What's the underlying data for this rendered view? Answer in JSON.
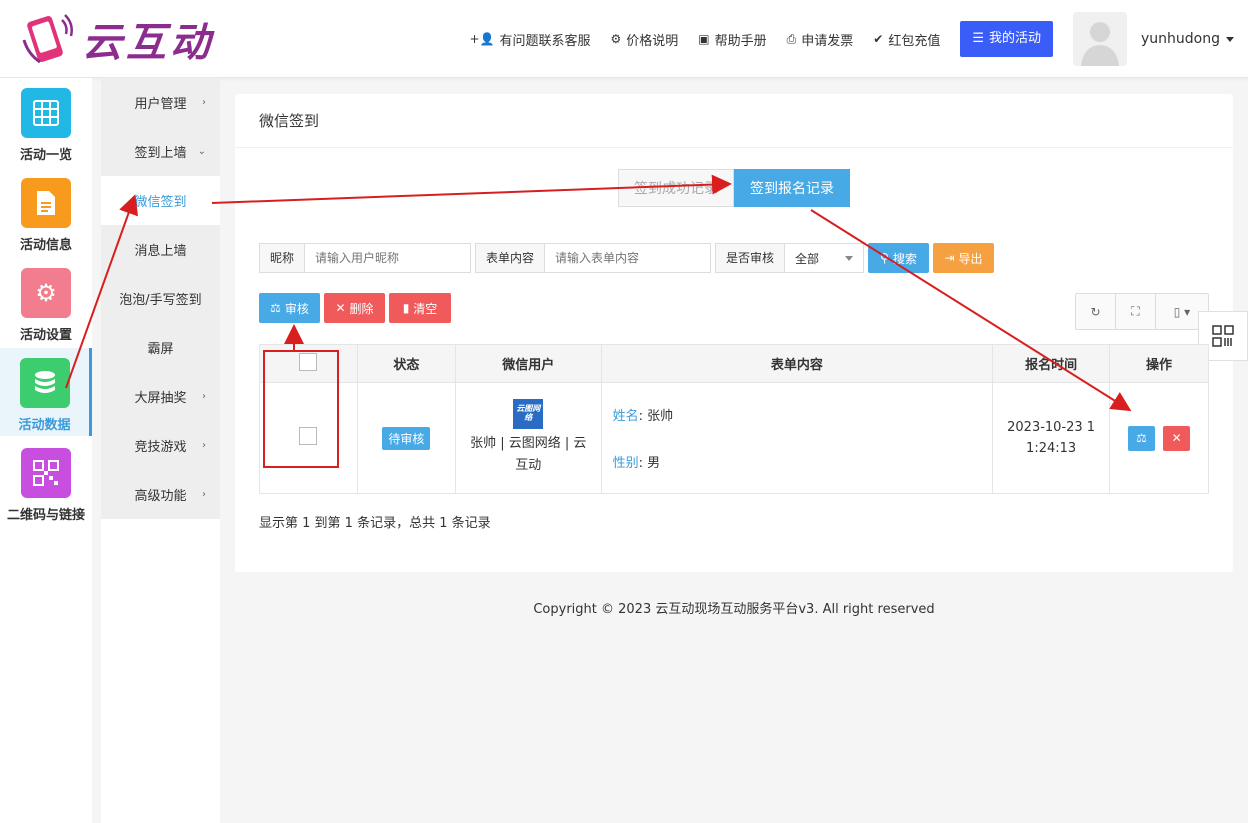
{
  "header": {
    "logo_text": "云互动",
    "nav": [
      {
        "icon": "user-plus-icon",
        "glyph": "+👤",
        "label": "有问题联系客服"
      },
      {
        "icon": "gear-icon",
        "glyph": "⚙",
        "label": "价格说明"
      },
      {
        "icon": "book-icon",
        "glyph": "▣",
        "label": "帮助手册"
      },
      {
        "icon": "printer-icon",
        "glyph": "⎙",
        "label": "申请发票"
      },
      {
        "icon": "shield-check-icon",
        "glyph": "✔",
        "label": "红包充值"
      }
    ],
    "my_activity_label": "我的活动",
    "username": "yunhudong"
  },
  "sidebar": {
    "items": [
      {
        "label": "活动一览",
        "icon": "grid-icon",
        "color": "#22b8e6"
      },
      {
        "label": "活动信息",
        "icon": "document-icon",
        "color": "#f79a1e"
      },
      {
        "label": "活动设置",
        "icon": "gear-icon",
        "color": "#f27d8e"
      },
      {
        "label": "活动数据",
        "icon": "database-icon",
        "color": "#3dcc6e"
      },
      {
        "label": "二维码与链接",
        "icon": "qrcode-icon",
        "color": "#c84ee0"
      }
    ]
  },
  "subnav": {
    "items": [
      {
        "label": "用户管理",
        "arrow": "›"
      },
      {
        "label": "签到上墙",
        "arrow": "⌄"
      },
      {
        "label": "微信签到",
        "arrow": ""
      },
      {
        "label": "消息上墙",
        "arrow": ""
      },
      {
        "label": "泡泡/手写签到",
        "arrow": ""
      },
      {
        "label": "霸屏",
        "arrow": ""
      },
      {
        "label": "大屏抽奖",
        "arrow": "›"
      },
      {
        "label": "竞技游戏",
        "arrow": "›"
      },
      {
        "label": "高级功能",
        "arrow": "›"
      }
    ]
  },
  "panel": {
    "title": "微信签到",
    "tabs": [
      "签到成功记录",
      "签到报名记录"
    ],
    "filters": {
      "nickname_label": "昵称",
      "nickname_placeholder": "请输入用户昵称",
      "form_label": "表单内容",
      "form_placeholder": "请输入表单内容",
      "review_label": "是否审核",
      "review_value": "全部",
      "search_label": "搜索",
      "export_label": "导出"
    },
    "actions": {
      "review_label": "审核",
      "delete_label": "删除",
      "clear_label": "清空"
    },
    "table": {
      "headers": [
        "",
        "状态",
        "微信用户",
        "表单内容",
        "报名时间",
        "操作"
      ],
      "rows": [
        {
          "status": "待审核",
          "avatar_text": "云图网络",
          "user": "张帅 | 云图网络 | 云互动",
          "form_name_key": "姓名",
          "form_name_val": "张帅",
          "form_gender_key": "性别",
          "form_gender_val": "男",
          "time": "2023-10-23 11:24:13"
        }
      ]
    },
    "summary": "显示第 1 到第 1 条记录，总共 1 条记录"
  },
  "footer": "Copyright © 2023 云互动现场互动服务平台v3. All right reserved",
  "colors": {
    "accent_blue": "#47a9e6",
    "brand_purple": "#8b2c8f",
    "danger": "#f05a5a",
    "warning": "#f5a142",
    "annotation_red": "#d81e1e"
  }
}
